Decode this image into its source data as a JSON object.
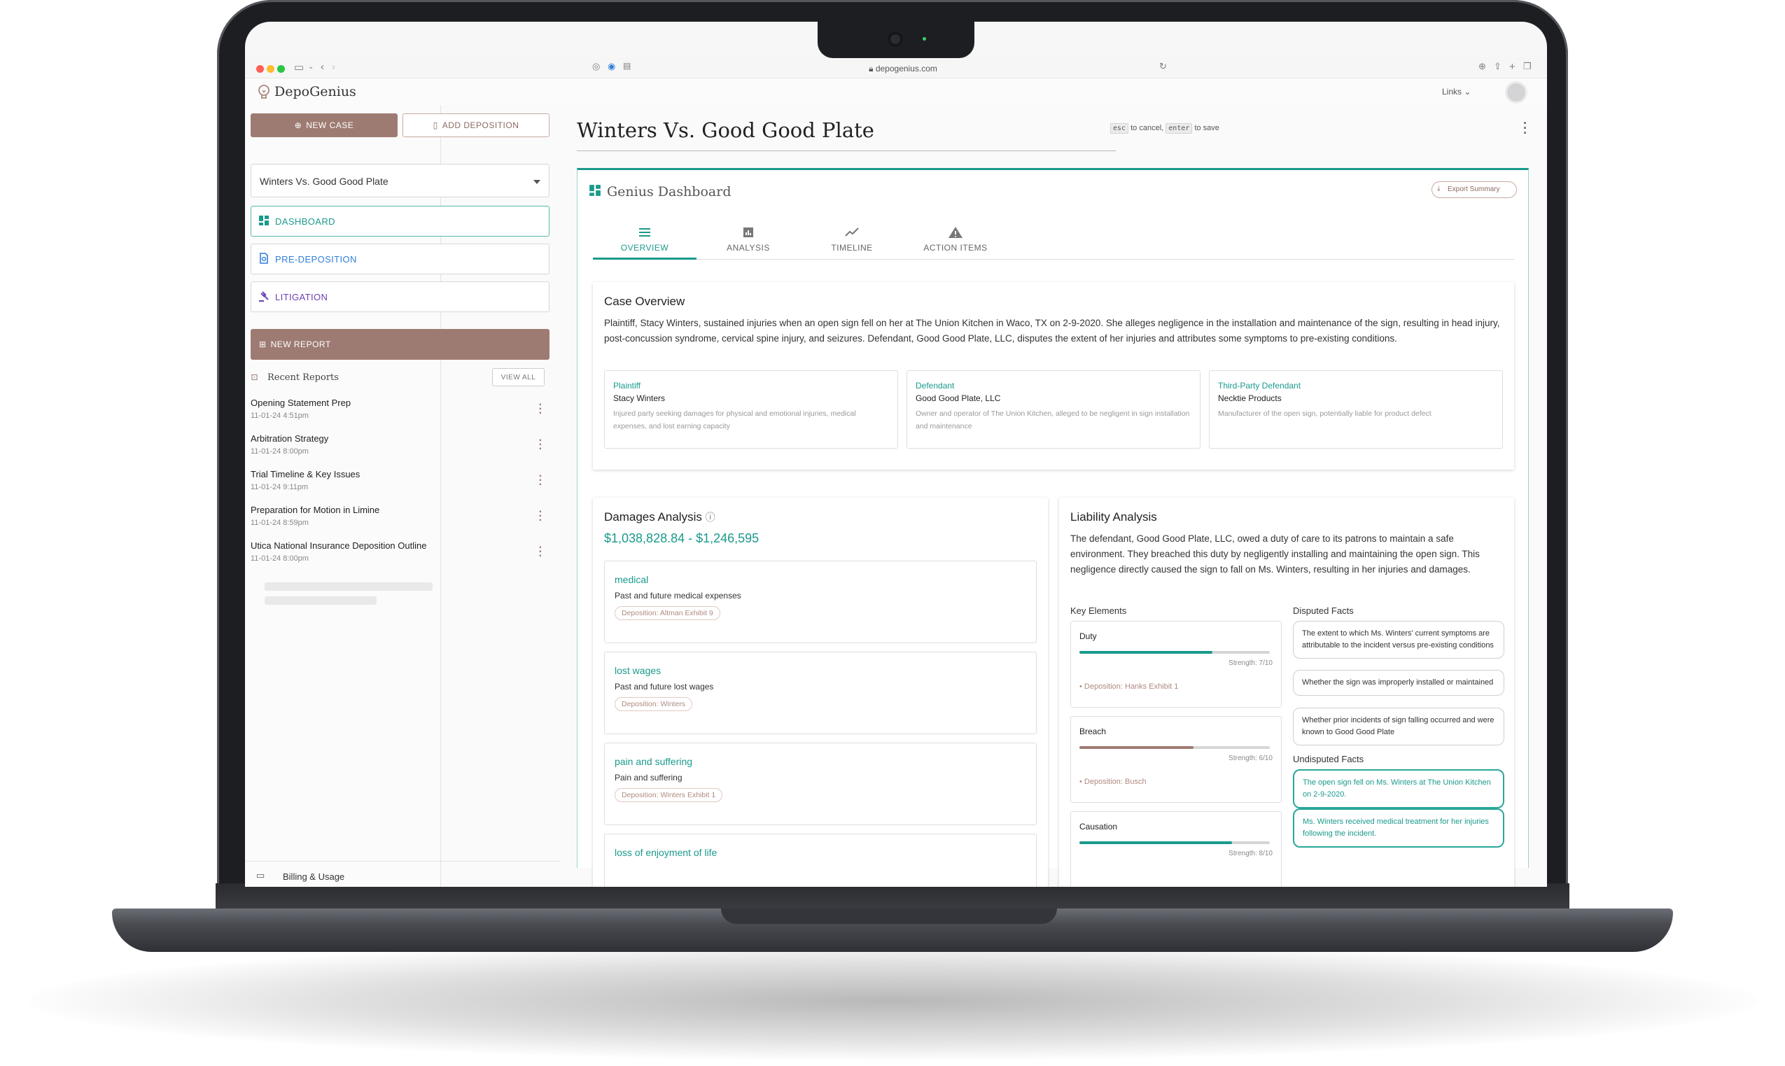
{
  "browser": {
    "url": "depogenius.com"
  },
  "header": {
    "brand": "DepoGenius",
    "links_label": "Links"
  },
  "sidebar": {
    "new_case": "NEW CASE",
    "add_deposition": "ADD DEPOSITION",
    "selected_case": "Winters Vs. Good Good Plate",
    "nav": [
      {
        "label": "DASHBOARD",
        "color": "#1a9a8c"
      },
      {
        "label": "PRE-DEPOSITION",
        "color": "#2f7fd8"
      },
      {
        "label": "LITIGATION",
        "color": "#6a3fb5"
      }
    ],
    "new_report": "NEW REPORT",
    "recent_title": "Recent Reports",
    "view_all": "VIEW ALL",
    "reports": [
      {
        "name": "Opening Statement Prep",
        "date": "11-01-24 4:51pm"
      },
      {
        "name": "Arbitration Strategy",
        "date": "11-01-24 8:00pm"
      },
      {
        "name": "Trial Timeline & Key Issues",
        "date": "11-01-24 9:11pm"
      },
      {
        "name": "Preparation for Motion in Limine",
        "date": "11-01-24 8:59pm"
      },
      {
        "name": "Utica National Insurance Deposition Outline",
        "date": "11-01-24 8:00pm"
      }
    ],
    "billing": "Billing & Usage"
  },
  "main": {
    "case_title": "Winters Vs. Good Good Plate",
    "hint": {
      "key1": "esc",
      "text1": "to cancel,",
      "key2": "enter",
      "text2": "to save"
    },
    "dashboard_title": "Genius Dashboard",
    "export_label": "Export Summary",
    "tabs": [
      "OVERVIEW",
      "ANALYSIS",
      "TIMELINE",
      "ACTION ITEMS"
    ],
    "overview": {
      "title": "Case Overview",
      "text": "Plaintiff, Stacy Winters, sustained injuries when an open sign fell on her at The Union Kitchen in Waco, TX on 2-9-2020. She alleges negligence in the installation and maintenance of the sign, resulting in head injury, post-concussion syndrome, cervical spine injury, and seizures. Defendant, Good Good Plate, LLC, disputes the extent of her injuries and attributes some symptoms to pre-existing conditions.",
      "parties": [
        {
          "role": "Plaintiff",
          "name": "Stacy Winters",
          "desc": "Injured party seeking damages for physical and emotional injuries, medical expenses, and lost earning capacity"
        },
        {
          "role": "Defendant",
          "name": "Good Good Plate, LLC",
          "desc": "Owner and operator of The Union Kitchen, alleged to be negligent in sign installation and maintenance"
        },
        {
          "role": "Third-Party Defendant",
          "name": "Necktie Products",
          "desc": "Manufacturer of the open sign, potentially liable for product defect"
        }
      ]
    },
    "damages": {
      "title": "Damages Analysis",
      "range": "$1,038,828.84 - $1,246,595",
      "items": [
        {
          "name": "medical",
          "desc": "Past and future medical expenses",
          "source": "Deposition: Altman Exhibit 9"
        },
        {
          "name": "lost wages",
          "desc": "Past and future lost wages",
          "source": "Deposition: Winters"
        },
        {
          "name": "pain and suffering",
          "desc": "Pain and suffering",
          "source": "Deposition: Winters Exhibit 1"
        },
        {
          "name": "loss of enjoyment of life",
          "desc": "",
          "source": ""
        }
      ]
    },
    "liability": {
      "title": "Liability Analysis",
      "text": "The defendant, Good Good Plate, LLC, owed a duty of care to its patrons to maintain a safe environment. They breached this duty by negligently installing and maintaining the open sign. This negligence directly caused the sign to fall on Ms. Winters, resulting in her injuries and damages.",
      "key_elements_label": "Key Elements",
      "disputed_label": "Disputed Facts",
      "undisputed_label": "Undisputed Facts",
      "elements": [
        {
          "name": "Duty",
          "strength": 7,
          "strength_label": "Strength: 7/10",
          "source": "• Deposition: Hanks Exhibit 1",
          "color": "#1a9a8c"
        },
        {
          "name": "Breach",
          "strength": 6,
          "strength_label": "Strength: 6/10",
          "source": "• Deposition: Busch",
          "color": "#9e7b72"
        },
        {
          "name": "Causation",
          "strength": 8,
          "strength_label": "Strength: 8/10",
          "source": "",
          "color": "#1a9a8c"
        }
      ],
      "disputed": [
        "The extent to which Ms. Winters' current symptoms are attributable to the incident versus pre-existing conditions",
        "Whether the sign was improperly installed or maintained",
        "Whether prior incidents of sign falling occurred and were known to Good Good Plate"
      ],
      "undisputed": [
        "The open sign fell on Ms. Winters at The Union Kitchen on 2-9-2020.",
        "Ms. Winters received medical treatment for her injuries following the incident."
      ]
    }
  },
  "colors": {
    "accent": "#1a9a8c",
    "brand_brown": "#9e7b72"
  }
}
